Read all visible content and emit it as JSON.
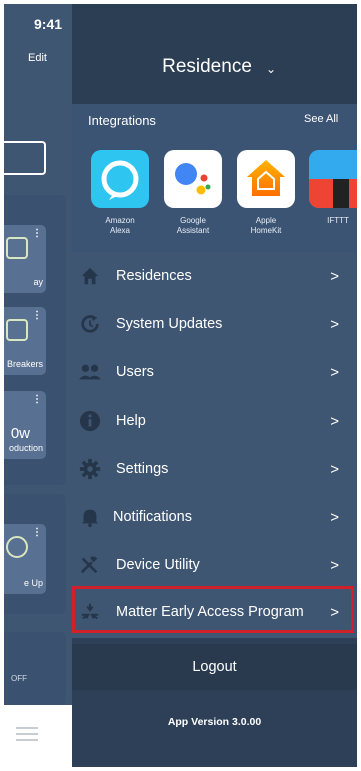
{
  "status_bar": {
    "time": "9:41"
  },
  "background_screen": {
    "edit_label": "Edit",
    "tiles": [
      {
        "label": "ay"
      },
      {
        "label": "Breakers"
      },
      {
        "value": "0w",
        "label": "oduction"
      },
      {
        "label": "e Up"
      }
    ],
    "off_label": "OFF"
  },
  "drawer": {
    "title": "Residence",
    "integrations": {
      "label": "Integrations",
      "see_all": "See All",
      "items": [
        {
          "name_line1": "Amazon",
          "name_line2": "Alexa"
        },
        {
          "name_line1": "Google",
          "name_line2": "Assistant"
        },
        {
          "name_line1": "Apple",
          "name_line2": "HomeKit"
        },
        {
          "name_line1": "IFTTT",
          "name_line2": ""
        }
      ]
    },
    "menu": [
      {
        "label": "Residences",
        "icon": "home-icon"
      },
      {
        "label": "System Updates",
        "icon": "update-icon"
      },
      {
        "label": "Users",
        "icon": "users-icon"
      },
      {
        "label": "Help",
        "icon": "info-icon"
      },
      {
        "label": "Settings",
        "icon": "gear-icon"
      },
      {
        "label": "Notifications",
        "icon": "bell-icon"
      },
      {
        "label": "Device Utility",
        "icon": "tools-icon"
      },
      {
        "label": "Matter Early Access Program",
        "icon": "matter-icon"
      }
    ],
    "logout": "Logout",
    "version": "App Version 3.0.00"
  },
  "colors": {
    "drawer_bg": "#3f5672",
    "header_bg": "#2c3e53",
    "highlight": "#d0202a"
  }
}
